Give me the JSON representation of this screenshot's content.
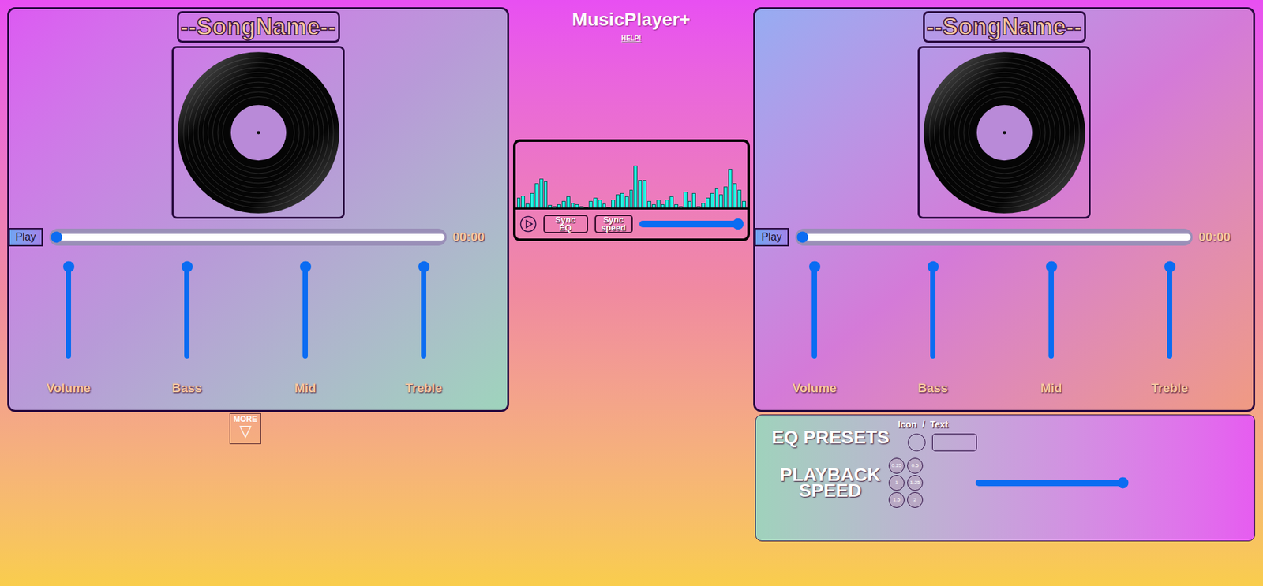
{
  "app": {
    "title": "MusicPlayer+",
    "help": "HELP!"
  },
  "decks": [
    {
      "song": "--SongName--",
      "play_button": "Play",
      "progress": 0,
      "time": "00:00",
      "sliders": [
        {
          "label": "Volume",
          "level": 1
        },
        {
          "label": "Bass",
          "level": 1
        },
        {
          "label": "Mid",
          "level": 1
        },
        {
          "label": "Treble",
          "level": 1
        }
      ]
    },
    {
      "song": "--SongName--",
      "play_button": "Play",
      "progress": 0,
      "time": "00:00",
      "sliders": [
        {
          "label": "Volume",
          "level": 1
        },
        {
          "label": "Bass",
          "level": 1
        },
        {
          "label": "Mid",
          "level": 1
        },
        {
          "label": "Treble",
          "level": 1
        }
      ]
    }
  ],
  "more_button": {
    "label": "MORE",
    "arrow": "▽"
  },
  "mixer": {
    "bars": [
      15,
      18,
      6,
      22,
      37,
      44,
      40,
      4,
      2,
      5,
      10,
      17,
      7,
      5,
      2,
      1,
      10,
      15,
      12,
      6,
      1,
      12,
      20,
      22,
      17,
      27,
      64,
      42,
      42,
      10,
      5,
      12,
      5,
      12,
      17,
      5,
      2,
      24,
      10,
      22,
      2,
      7,
      15,
      22,
      29,
      20,
      32,
      59,
      37,
      27,
      10
    ],
    "buttons": [
      "Sync EQ",
      "Sync speed"
    ],
    "crossfader_level": 1
  },
  "presets": {
    "eq_title": "EQ PRESETS",
    "mode_labels": [
      "Icon",
      "Text"
    ],
    "mode_separator": "/",
    "speed_title": "PLAYBACK SPEED",
    "speeds": [
      "0.25",
      "0.5",
      "1",
      "1.25",
      "1.5",
      "2"
    ],
    "speed_level": 1
  }
}
